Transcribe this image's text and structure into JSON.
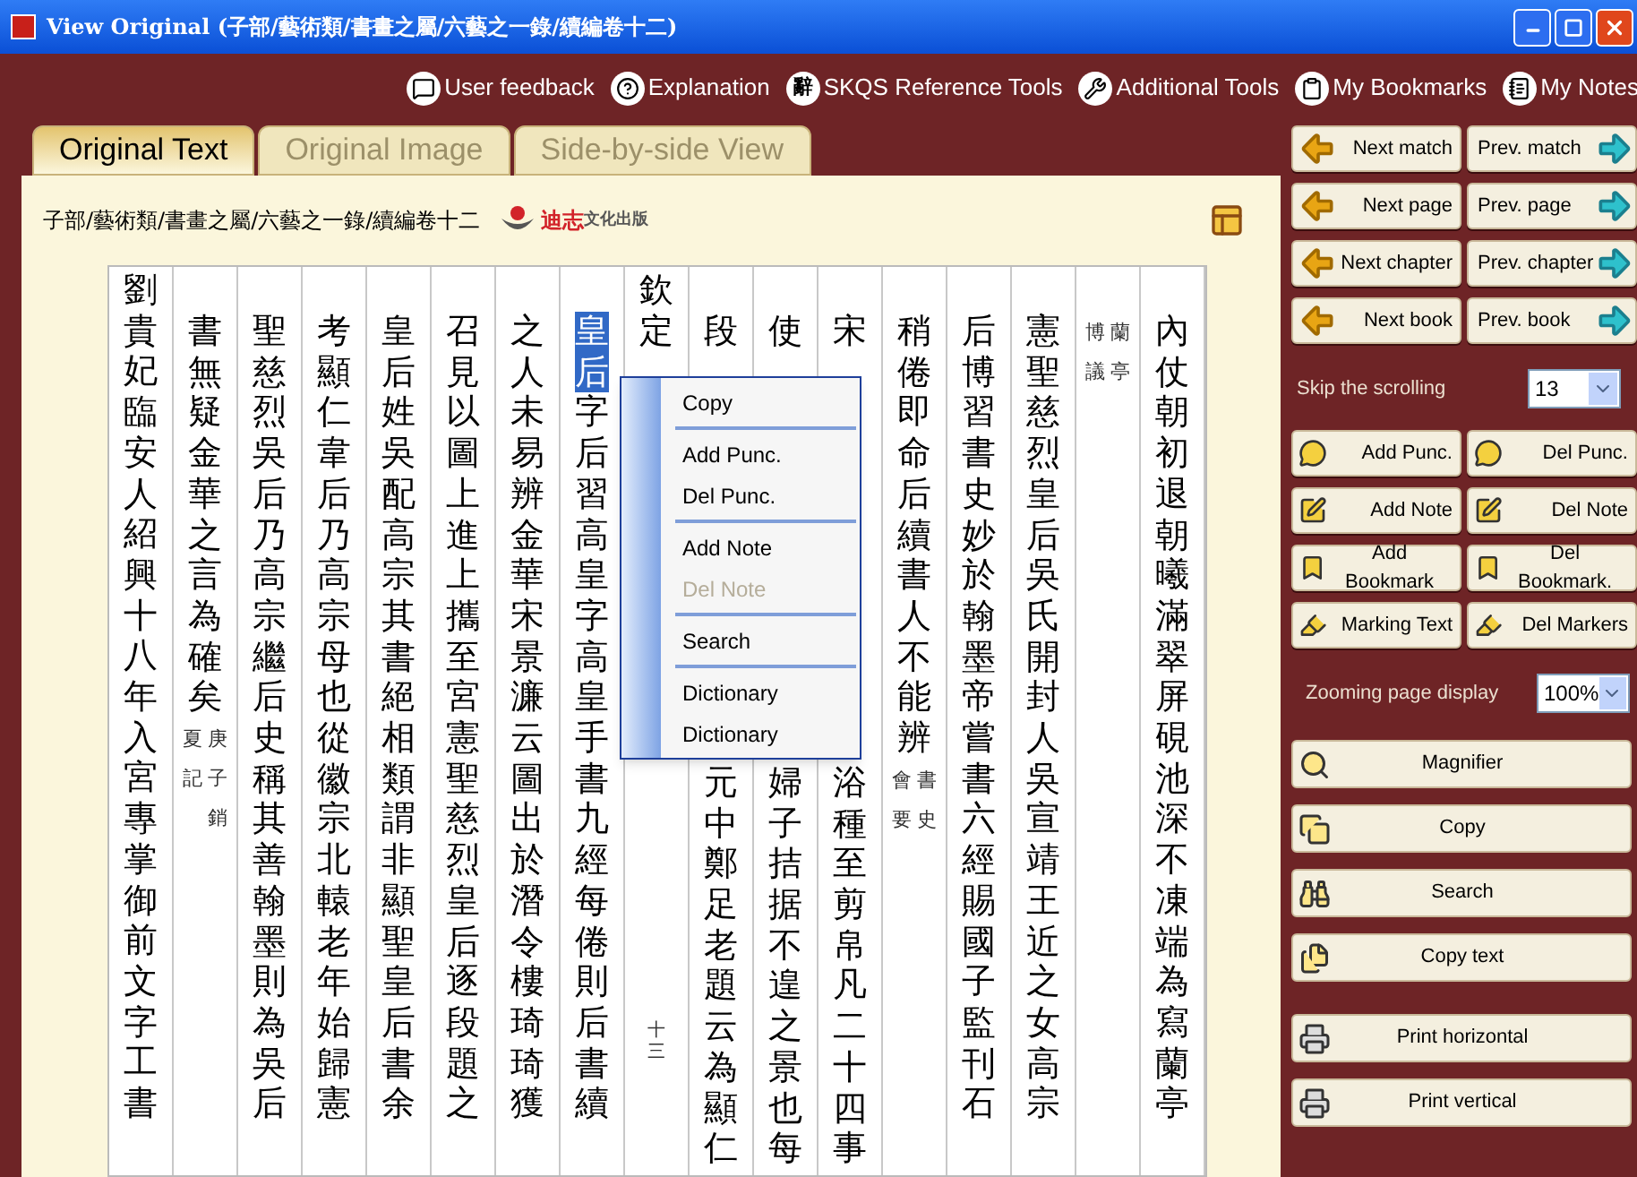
{
  "window": {
    "title": "View Original (子部/藝術類/書畫之屬/六藝之一錄/續編卷十二)"
  },
  "toolbar": [
    {
      "label": "User feedback"
    },
    {
      "label": "Explanation"
    },
    {
      "label": "SKQS Reference Tools",
      "glyph": "辭"
    },
    {
      "label": "Additional Tools"
    },
    {
      "label": "My Bookmarks"
    },
    {
      "label": "My Notes"
    }
  ],
  "tabs": [
    {
      "label": "Original Text",
      "selected": true
    },
    {
      "label": "Original Image",
      "selected": false
    },
    {
      "label": "Side-by-side View",
      "selected": false
    }
  ],
  "breadcrumb": "子部/藝術類/書畫之屬/六藝之一錄/續編卷十二",
  "logo": {
    "name": "迪志",
    "sub": "文化出版"
  },
  "columns": [
    {
      "raised": true,
      "segments": [
        {
          "text": "劉貴妃臨安人紹興十八年入宮專掌御前文字工書",
          "selected": false
        }
      ]
    },
    {
      "raised": false,
      "segments": [
        {
          "text": "書無疑金華之言為確矣",
          "selected": false
        }
      ],
      "notes": [
        "夏記",
        "庚子銷"
      ]
    },
    {
      "raised": false,
      "segments": [
        {
          "text": "聖慈烈吳后乃高宗繼后史稱其善翰墨則為吳后",
          "selected": false
        }
      ]
    },
    {
      "raised": false,
      "segments": [
        {
          "text": "考顯仁韋后乃高宗母也從徽宗北轅老年始歸憲",
          "selected": false
        }
      ]
    },
    {
      "raised": false,
      "segments": [
        {
          "text": "皇后姓吳配高宗其書絕相類謂非顯聖皇后書余",
          "selected": false
        }
      ]
    },
    {
      "raised": false,
      "segments": [
        {
          "text": "召見以圖上進上攜至宮憲聖慈烈皇后逐段題之",
          "selected": false
        }
      ]
    },
    {
      "raised": false,
      "segments": [
        {
          "text": "之人未易辨金華宋景濂云圖出於潛令樓琦琦獲",
          "selected": false
        }
      ]
    },
    {
      "raised": false,
      "segments": [
        {
          "text": "皇后",
          "selected": true
        },
        {
          "text": "字后習高皇字高皇手書九經每倦則后書續",
          "selected": false
        }
      ]
    },
    {
      "raised": true,
      "segments": [
        {
          "text": "欽定",
          "selected": false
        }
      ],
      "bottom": {
        "text": "十三",
        "small": true
      }
    },
    {
      "raised": false,
      "segments": [
        {
          "text": "段",
          "selected": false
        }
      ],
      "bottom": {
        "text": "元中鄭足老題云為顯仁",
        "small": false
      }
    },
    {
      "raised": false,
      "segments": [
        {
          "text": "使",
          "selected": false
        }
      ],
      "bottom": {
        "text": "婦子拮据不遑之景也每",
        "small": false
      }
    },
    {
      "raised": false,
      "segments": [
        {
          "text": "宋",
          "selected": false
        }
      ],
      "bottom": {
        "text": "浴種至剪帛凡二十四事",
        "small": false
      }
    },
    {
      "raised": false,
      "segments": [
        {
          "text": "稍倦即命后續書人不能辨",
          "selected": false
        }
      ],
      "notes": [
        "會要",
        "書史"
      ]
    },
    {
      "raised": false,
      "segments": [
        {
          "text": "后博習書史妙於翰墨帝嘗書六經賜國子監刊石",
          "selected": false
        }
      ]
    },
    {
      "raised": false,
      "segments": [
        {
          "text": "憲聖慈烈皇后吳氏開封人吳宣靖王近之女高宗",
          "selected": false
        }
      ]
    },
    {
      "raised": false,
      "notes": [
        "博議",
        "蘭亭"
      ]
    },
    {
      "raised": false,
      "segments": [
        {
          "text": "內仗朝初退朝曦滿翠屏硯池深不凍端為寫蘭亭",
          "selected": false
        }
      ]
    }
  ],
  "context_menu": {
    "groups": [
      [
        {
          "label": "Copy",
          "disabled": false
        }
      ],
      [
        {
          "label": "Add Punc.",
          "disabled": false
        },
        {
          "label": "Del Punc.",
          "disabled": false
        }
      ],
      [
        {
          "label": "Add Note",
          "disabled": false
        },
        {
          "label": "Del Note",
          "disabled": true
        }
      ],
      [
        {
          "label": "Search",
          "disabled": false
        }
      ],
      [
        {
          "label": "Dictionary",
          "disabled": false
        },
        {
          "label": "Dictionary",
          "disabled": false
        }
      ]
    ]
  },
  "nav_buttons": [
    {
      "left": "Next match",
      "right": "Prev. match"
    },
    {
      "left": "Next page",
      "right": "Prev. page"
    },
    {
      "left": "Next chapter",
      "right": "Prev. chapter"
    },
    {
      "left": "Next book",
      "right": "Prev. book"
    }
  ],
  "skip_scrolling": {
    "label": "Skip the scrolling",
    "value": "13"
  },
  "tool_buttons": [
    {
      "left": "Add Punc.",
      "right": "Del Punc."
    },
    {
      "left": "Add Note",
      "right": "Del Note"
    },
    {
      "left": "Add Bookmark",
      "right": "Del Bookmark."
    },
    {
      "left": "Marking Text",
      "right": "Del Markers"
    }
  ],
  "zoom": {
    "label": "Zooming page display",
    "value": "100%"
  },
  "wide_buttons": [
    {
      "label": "Magnifier",
      "kind": "tool"
    },
    {
      "label": "Copy",
      "kind": "tool"
    },
    {
      "label": "Search",
      "kind": "tool"
    },
    {
      "label": "Copy text",
      "kind": "tool"
    },
    {
      "label": "Print horizontal",
      "kind": "print"
    },
    {
      "label": "Print vertical",
      "kind": "print"
    }
  ]
}
